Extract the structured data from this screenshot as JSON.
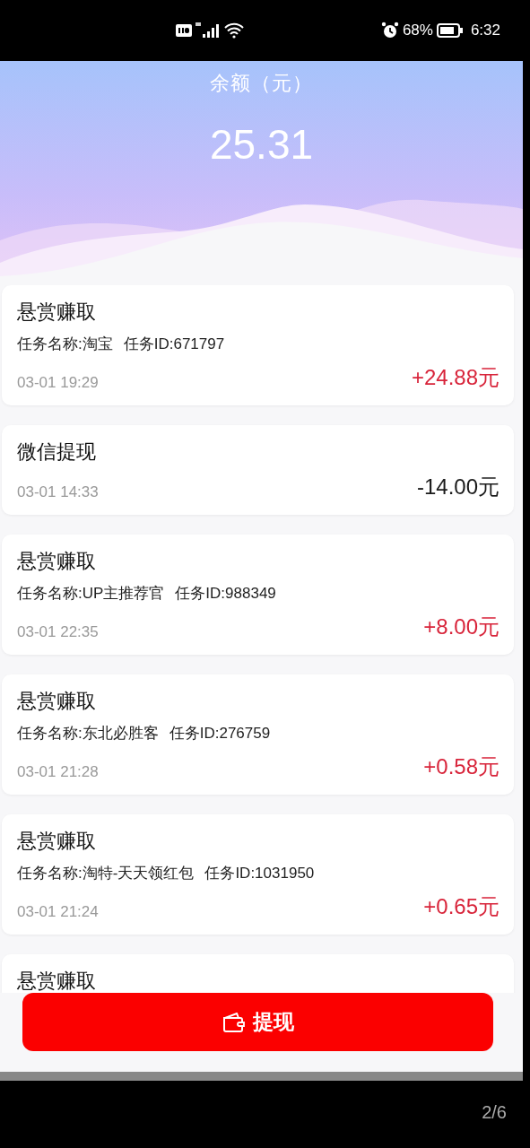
{
  "status_bar": {
    "battery_text": "68%",
    "time": "6:32"
  },
  "balance": {
    "label": "余额（元）",
    "amount": "25.31"
  },
  "records": [
    {
      "kind": "income",
      "title": "悬赏赚取",
      "task_name": "任务名称:淘宝",
      "task_id": "任务ID:671797",
      "time": "03-01 19:29",
      "amount": "+24.88元"
    },
    {
      "kind": "withdraw",
      "title": "微信提现",
      "time": "03-01 14:33",
      "amount": "-14.00元"
    },
    {
      "kind": "income",
      "title": "悬赏赚取",
      "task_name": "任务名称:UP主推荐官",
      "task_id": "任务ID:988349",
      "time": "03-01 22:35",
      "amount": "+8.00元"
    },
    {
      "kind": "income",
      "title": "悬赏赚取",
      "task_name": "任务名称:东北必胜客",
      "task_id": "任务ID:276759",
      "time": "03-01 21:28",
      "amount": "+0.58元"
    },
    {
      "kind": "income",
      "title": "悬赏赚取",
      "task_name": "任务名称:淘特-天天领红包",
      "task_id": "任务ID:1031950",
      "time": "03-01 21:24",
      "amount": "+0.65元"
    },
    {
      "title": "悬赏赚取"
    }
  ],
  "withdraw_button": {
    "label": "提现"
  },
  "page_indicator": "2/6"
}
